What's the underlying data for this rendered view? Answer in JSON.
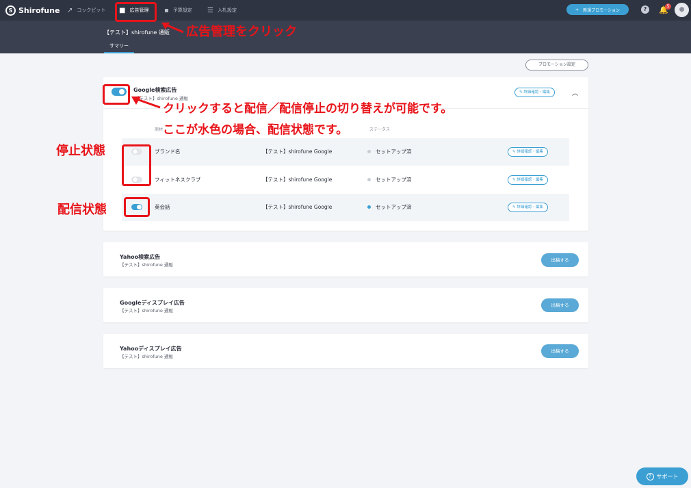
{
  "nav": {
    "brand": "Shirofune",
    "items": [
      {
        "label": "コックピット",
        "icon": "trend-icon"
      },
      {
        "label": "広告管理",
        "icon": "folder-icon"
      },
      {
        "label": "予算設定",
        "icon": "wallet-icon"
      },
      {
        "label": "入札設定",
        "icon": "sliders-icon"
      }
    ],
    "new_promotion": "新規プロモーション",
    "notification_count": "5"
  },
  "header": {
    "account": "【テスト】shirofune 通販",
    "tab": "サマリー"
  },
  "promotion_settings": "プロモーション設定",
  "google_search": {
    "title": "Google検索広告",
    "account": "【テスト】shirofune 通販",
    "edit": "詳細確認・編集",
    "columns": {
      "campaign": "商材",
      "status_col": "ステータス"
    },
    "rows": [
      {
        "name": "ブランド名",
        "account": "【テスト】shirofune Google",
        "status": "セットアップ済",
        "edit": "詳細確認・編集",
        "enabled": false
      },
      {
        "name": "フィットネスクラブ",
        "account": "【テスト】shirofune Google",
        "status": "セットアップ済",
        "edit": "詳細確認・編集",
        "enabled": false
      },
      {
        "name": "英会話",
        "account": "【テスト】shirofune Google",
        "status": "セットアップ済",
        "edit": "詳細確認・編集",
        "enabled": true
      }
    ]
  },
  "cards": [
    {
      "title": "Yahoo検索広告",
      "account": "【テスト】shirofune 通販",
      "button": "出稿する"
    },
    {
      "title": "Googleディスプレイ広告",
      "account": "【テスト】shirofune 通販",
      "button": "出稿する"
    },
    {
      "title": "Yahooディスプレイ広告",
      "account": "【テスト】shirofune 通販",
      "button": "出稿する"
    }
  ],
  "annotations": {
    "click_ad_mgmt": "広告管理をクリック",
    "toggle_note_1": "クリックすると配信／配信停止の切り替えが可能です。",
    "toggle_note_2": "ここが水色の場合、配信状態です。",
    "stopped": "停止状態",
    "active": "配信状態"
  },
  "support": "サポート",
  "colors": {
    "accent": "#3b9fd3",
    "annotation": "#e8141a",
    "nav_bg": "#2f3442"
  }
}
